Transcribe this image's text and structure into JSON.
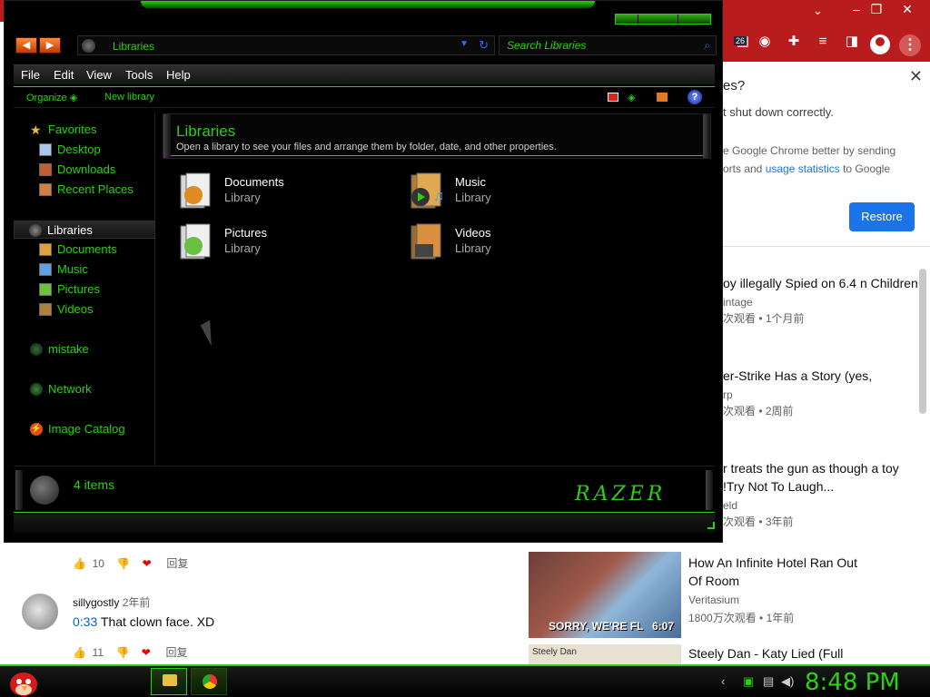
{
  "explorer": {
    "address": "Libraries",
    "search_placeholder": "Search Libraries",
    "menu": [
      "File",
      "Edit",
      "View",
      "Tools",
      "Help"
    ],
    "commands": {
      "organize": "Organize",
      "new_library": "New library"
    },
    "sidebar": {
      "favorites": "Favorites",
      "favorites_items": [
        "Desktop",
        "Downloads",
        "Recent Places"
      ],
      "libraries": "Libraries",
      "libraries_items": [
        "Documents",
        "Music",
        "Pictures",
        "Videos"
      ],
      "mistake": "mistake",
      "network": "Network",
      "image_catalog": "Image Catalog"
    },
    "header": {
      "title": "Libraries",
      "subtitle": "Open a library to see your files and arrange them by folder, date, and other properties."
    },
    "libraries": [
      {
        "name": "Documents",
        "type": "Library"
      },
      {
        "name": "Music",
        "type": "Library"
      },
      {
        "name": "Pictures",
        "type": "Library"
      },
      {
        "name": "Videos",
        "type": "Library"
      }
    ],
    "status": {
      "count": "4 items",
      "brand": "RAZER"
    }
  },
  "chrome": {
    "badge": "26",
    "restore_popup": {
      "title_fragment": "es?",
      "line": "t shut down correctly.",
      "body_a": "e Google Chrome better by sending",
      "body_b": "orts and",
      "link": "usage statistics",
      "body_c": "to Google",
      "button": "Restore"
    },
    "videos": [
      {
        "title": "oy illegally Spied on 6.4 n Children",
        "channel": "intage",
        "meta": "次观看 • 1个月前"
      },
      {
        "title": "er-Strike Has a Story (yes,",
        "channel": "rp",
        "meta": "次观看 • 2周前"
      },
      {
        "title": "r treats the gun as though a toy !Try Not To Laugh...",
        "channel": "eld",
        "meta": "次观看 • 3年前"
      }
    ],
    "related": [
      {
        "title": "How An Infinite Hotel Ran Out Of Room",
        "channel": "Veritasium",
        "meta": "1800万次观看 • 1年前",
        "caption": "SORRY, WE'RE FL",
        "duration": "6:07"
      },
      {
        "title": "Steely Dan - Katy Lied (Full",
        "thumb_text": "Steely Dan"
      }
    ],
    "comments": {
      "likes1": "10",
      "reply": "回复",
      "user": "sillygostly",
      "user_time": "2年前",
      "timestamp": "0:33",
      "text": "That clown face. XD",
      "likes2": "11"
    }
  },
  "taskbar": {
    "clock": "8:48 PM"
  },
  "colors": {
    "accent": "#2bd10f",
    "chrome_red": "#b91c1c",
    "link_blue": "#1a73e8"
  }
}
